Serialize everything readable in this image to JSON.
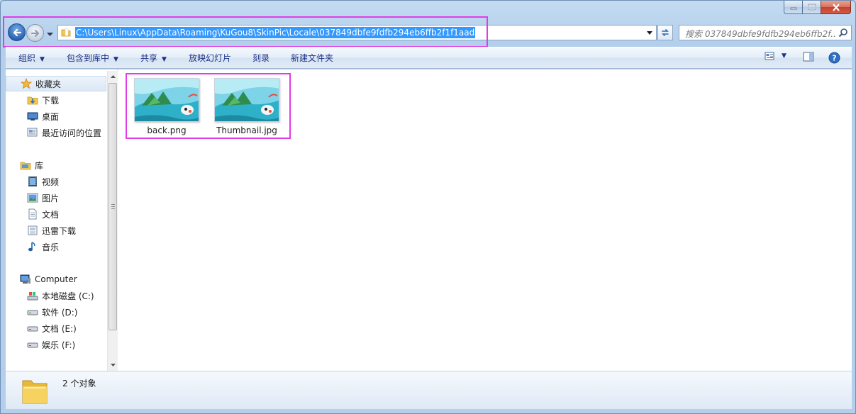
{
  "address": {
    "path": "C:\\Users\\Linux\\AppData\\Roaming\\KuGou8\\SkinPic\\Locale\\037849dbfe9fdfb294eb6ffb2f1f1aad"
  },
  "search": {
    "placeholder": "搜索 037849dbfe9fdfb294eb6ffb2f..."
  },
  "toolbar": {
    "organize": "组织",
    "include_in_library": "包含到库中",
    "share": "共享",
    "slideshow": "放映幻灯片",
    "burn": "刻录",
    "new_folder": "新建文件夹"
  },
  "nav": {
    "favorites": "收藏夹",
    "downloads": "下载",
    "desktop": "桌面",
    "recent": "最近访问的位置",
    "libraries": "库",
    "videos": "视频",
    "pictures": "图片",
    "documents": "文档",
    "xunlei": "迅雷下载",
    "music": "音乐",
    "computer": "Computer",
    "drive_c": "本地磁盘 (C:)",
    "drive_d": "软件 (D:)",
    "drive_e": "文档 (E:)",
    "drive_f": "娱乐 (F:)"
  },
  "files": [
    {
      "name": "back.png"
    },
    {
      "name": "Thumbnail.jpg"
    }
  ],
  "status": {
    "item_count": "2 个对象"
  },
  "colors": {
    "highlight": "#e23be7",
    "selection": "#3399ff",
    "toolbar_text": "#1e3287"
  }
}
